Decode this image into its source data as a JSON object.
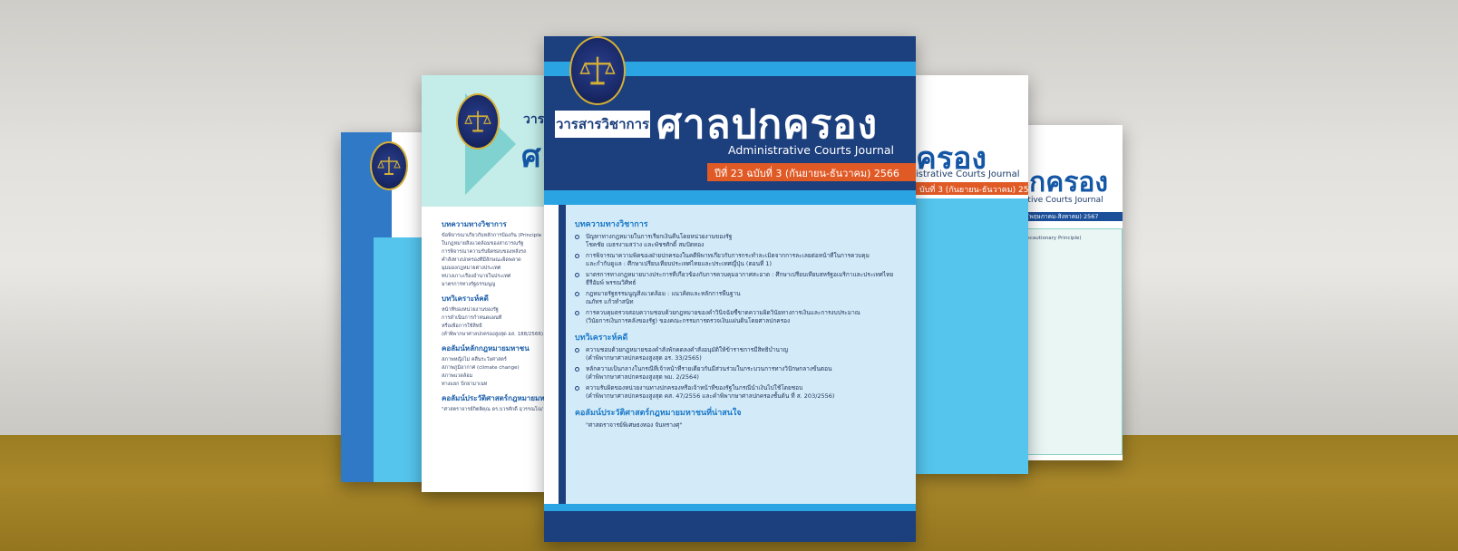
{
  "main_cover": {
    "label": "วารสารวิชาการ",
    "title": "ศาลปกครอง",
    "subtitle": "Administrative Courts Journal",
    "volume": "ปีที่ 23 ฉบับที่ 3 (กันยายน-ธันวาคม) 2566",
    "sections": [
      {
        "heading": "บทความทางวิชาการ",
        "items": [
          {
            "title": "ปัญหาทางกฎหมายในการเรียกเงินคืนโดยหน่วยงานของรัฐ",
            "author": "โชคชัย เมธรงามสว่าง และพัชรศักดิ์ สมปัตทอง"
          },
          {
            "title": "การพิจารณาความพิดของฝ่ายปกครองในคดีพิพาทเกี่ยวกับการกระทำละเมิดจากการละเลยต่อหน้าที่ในการควบคุม",
            "author": "และกำกับดูแล : ศึกษาเปรียบเทียบประเทศไทยและประเทศญี่ปุ่น (ตอนที่ 1)"
          },
          {
            "title": "มาตรการทางกฎหมายบางประการที่เกี่ยวข้องกับการควบคุมอากาศสะอาด : ศึกษาเปรียบเทียบสหรัฐอเมริกาและประเทศไทย",
            "author": "ธีรีอัมพ์ พรรณวิศิทธ์"
          },
          {
            "title": "กฎหมายรัฐธรรมนูญสิ่งแวดล้อม : แนวคิดและหลักการพื้นฐาน",
            "author": "ณภัทร แก้วทำสนิท"
          },
          {
            "title": "การควบคุมตรวจสอบความชอบด้วยกฎหมายของคำวินิจฉัยชี้ขาดความผิดวินัยทางการเงินและการงบประมาณ",
            "author": "(วินัยการเงินการคลังของรัฐ) ของคณะกรรมการตรวจเงินแผ่นดินโดยศาลปกครอง"
          }
        ]
      },
      {
        "heading": "บทวิเคราะห์คดี",
        "items": [
          {
            "title": "ความชอบด้วยกฎหมายของคำสั่งพักคดลงคำสั่งอนุมัติให้ข้าราชการมีสิทธิบำนาญ",
            "author": "(คำพิพากษาศาลปกครองสูงสุด อร. 33/2565)"
          },
          {
            "title": "หลักความเป็นกลางในกรณีที่เจ้าหน้าที่รายเดียวกันมีส่วนร่วมในกระบวนการทางวิปักษกลางขั้นตอน",
            "author": "(คำพิพากษาศาลปกครองสูงสุด พม. 2/2564)"
          },
          {
            "title": "ความรับผิดของหน่วยงานทางปกครองหรือเจ้าหน้าที่ของรัฐในกรณีนำเงินไปใช้โดยชอบ",
            "author": "(คำพิพากษาศาลปกครองสูงสุด คส. 47/2556 และคำพิพากษาศาลปกครองชั้นต้น ที่ ส. 203/2556)"
          }
        ]
      },
      {
        "heading": "คอลัมน์ประวัติศาสตร์กฎหมายมหาชนที่น่าสนใจ",
        "items": [
          {
            "title": "\"ศาสตราจารย์พิเศษธงทอง จันทรางศุ\"",
            "author": ""
          }
        ]
      }
    ]
  },
  "left_cover_2": {
    "label": "วาร",
    "title_fragment": "ศ",
    "sections": [
      {
        "heading": "บทความทางวิชาการ",
        "lines": [
          "ข้อพิจารณาเกี่ยวกับหลักการป้องกัน (Principle of",
          "ในกฎหมายสิ่งแวดล้อมของสาธารณรัฐ",
          "การพิจารณาความรับผิดชอบของหลังรถ",
          "คำสั่งทางปกครองที่มีลักษณะผิดพลาด",
          "มุมมองกฎหมายต่างประเทศ",
          "ทบวงเกาะเรื่องอำนาจในประเทศ",
          "มาตรการทางรัฐธรรมนูญ"
        ]
      },
      {
        "heading": "บทวิเคราะห์คดี",
        "lines": [
          "หน้าที่ของหน่วยงานของรัฐ",
          "การดำเนินการกำหนดแผนที่",
          "หรือเพื่อการใช้สิทธิ",
          "(คำพิพากษาศาลปกครองสูงสุด อส. 188/2566)"
        ]
      },
      {
        "heading": "คอลัมน์หลักกฎหมายมหาชน",
        "lines": [
          "สภาพหญิงไม่ คลื่นระวังศาสตร์",
          "สภาพภูมิอากาศ (climate change)",
          "สภาพแวดล้อม",
          "ทางแยก บิกยามาเนท"
        ]
      },
      {
        "heading": "คอลัมน์ประวัติศาสตร์กฎหมายมหาชนที่",
        "lines": [
          "\"ศาสตราจารย์กิตติคุณ ดร.บวรศักดิ์ อุวรรณโณ\""
        ]
      }
    ]
  },
  "right_cover_1": {
    "title_fragment": "ครอง",
    "subtitle_fragment": "istrative Courts Journal",
    "volume_fragment": "บับที่ 3 (กันยายน-ธันวาคม) 2565"
  },
  "right_cover_2": {
    "title_fragment": "ปกครอง",
    "subtitle_fragment": "strative Courts Journal",
    "volume_fragment": "ับที่ 2 (พฤษภาคม-สิงหาคม) 2567",
    "line": "(Precautionary Principle)"
  },
  "colors": {
    "navy": "#1c3f7e",
    "sky": "#2aa4e3",
    "orange": "#e05a26",
    "cyan_panel": "#55c5ee",
    "mint": "#c4ede9",
    "gold": "#d4af37"
  },
  "icons": [
    "scales-of-justice-seal-icon"
  ]
}
